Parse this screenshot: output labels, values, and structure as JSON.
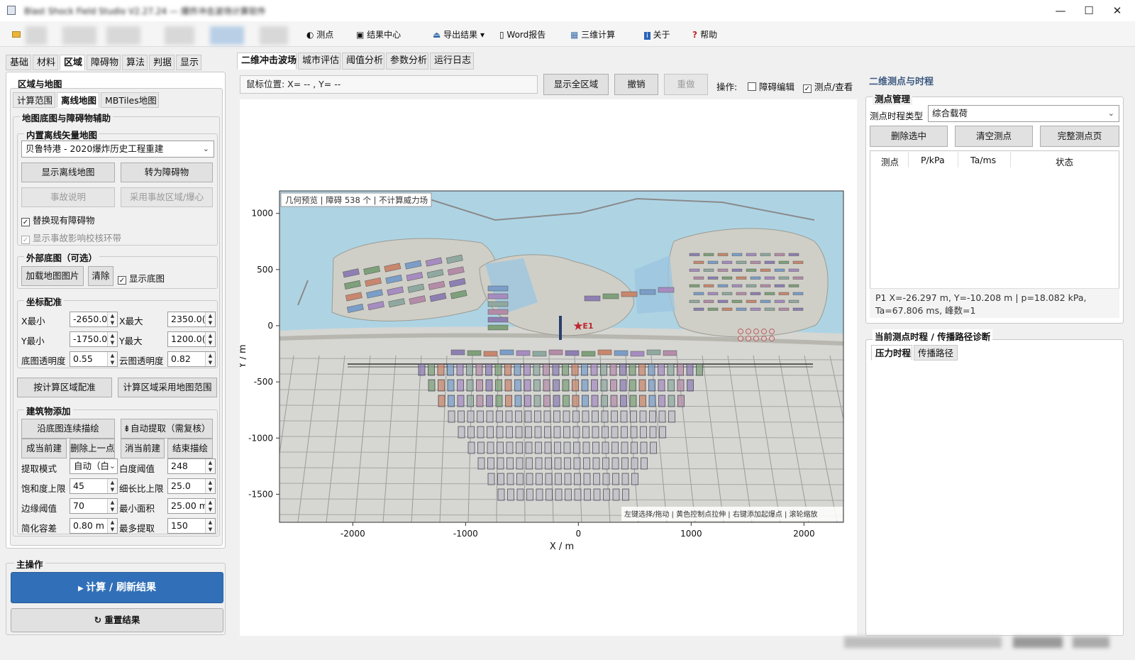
{
  "titlebar": {
    "min": "—",
    "max": "☐",
    "close": "✕"
  },
  "toolbar": {
    "measure": "测点",
    "results": "结果中心",
    "export": "导出结果",
    "word": "Word报告",
    "three_d": "三维计算",
    "about": "关于",
    "help": "帮助"
  },
  "left_tabs": [
    "基础",
    "材料",
    "区域",
    "障碍物",
    "算法",
    "判据",
    "显示"
  ],
  "region": {
    "title": "区域与地图",
    "subtabs": [
      "计算范围",
      "离线地图",
      "MBTiles地图"
    ],
    "basemap_title": "地图底图与障碍物辅助",
    "builtin_title": "内置离线矢量地图",
    "map_select": "贝鲁特港 - 2020爆炸历史工程重建",
    "show_offline": "显示离线地图",
    "to_obstacle": "转为障碍物",
    "accident_info": "事故说明",
    "use_accident": "采用事故区域/爆心",
    "replace_obstacles": "替换现有障碍物",
    "show_rings": "显示事故影响校核环带",
    "external_title": "外部底图（可选）",
    "load_image": "加载地图图片",
    "clear": "清除",
    "show_basemap": "显示底图",
    "coord_title": "坐标配准",
    "xmin_label": "X最小",
    "xmin": "-2650.0(",
    "xmax_label": "X最大",
    "xmax": "2350.0(",
    "ymin_label": "Y最小",
    "ymin": "-1750.0(",
    "ymax_label": "Y最大",
    "ymax": "1200.0(",
    "base_alpha_label": "底图透明度",
    "base_alpha": "0.55",
    "cloud_alpha_label": "云图透明度",
    "cloud_alpha": "0.82",
    "fit_region": "按计算区域配准",
    "use_map_range": "计算区域采用地图范围",
    "building_title": "建筑物添加",
    "trace": "沿底图连续描绘",
    "auto_extract": "⇟自动提取（需复核）",
    "finish_current": "成当前建",
    "delete_prev": "删除上一点",
    "cancel_current": "消当前建",
    "end_trace": "结束描绘",
    "mode_label": "提取模式",
    "mode": "自动（白",
    "white_label": "白度阈值",
    "white": "248",
    "sat_label": "饱和度上限",
    "sat": "45",
    "aspect_label": "细长比上限",
    "aspect": "25.0",
    "edge_label": "边缘阈值",
    "edge": "70",
    "min_area_label": "最小面积",
    "min_area": "25.00 m",
    "simplify_label": "简化容差",
    "simplify": "0.80 m",
    "max_extract_label": "最多提取",
    "max_extract": "150"
  },
  "main_ops": {
    "title": "主操作",
    "compute": "计算 / 刷新结果",
    "reset": "重置结果"
  },
  "center_tabs": [
    "二维冲击波场",
    "城市评估",
    "阈值分析",
    "参数分析",
    "运行日志"
  ],
  "center": {
    "mouse_pos": "鼠标位置:  X= -- , Y= --",
    "show_all": "显示全区域",
    "undo": "撤销",
    "redo": "重做",
    "ops_label": "操作:",
    "obstacle_edit": "障碍编辑",
    "probe_view": "测点/查看"
  },
  "chart_data": {
    "type": "scatter",
    "legend_text": "几何预览 | 障碍 538 个 | 不计算威力场",
    "hint": "左键选择/拖动 | 黄色控制点拉伸 | 右键添加起爆点 | 滚轮缩放",
    "xlabel": "X / m",
    "ylabel": "Y / m",
    "xlim": [
      -2650,
      2350
    ],
    "ylim": [
      -1750,
      1200
    ],
    "xticks": [
      "-2000",
      "-1000",
      "0",
      "1000",
      "2000"
    ],
    "yticks": [
      "1000",
      "500",
      "0",
      "-500",
      "-1000",
      "-1500"
    ],
    "points": [
      {
        "name": "E1",
        "x": 0,
        "y": 0
      }
    ]
  },
  "right": {
    "title": "二维测点与时程",
    "mgmt_title": "测点管理",
    "type_label": "测点时程类型",
    "type_value": "综合载荷",
    "del_selected": "删除选中",
    "clear_points": "清空测点",
    "full_page": "完整测点页",
    "columns": [
      "测点",
      "P/kPa",
      "Ta/ms",
      "状态"
    ],
    "info_line1": "P1  X=-26.297 m, Y=-10.208 m  |  p=18.082 kPa,",
    "info_line2": "Ta=67.806 ms, 峰数=1",
    "history_title": "当前测点时程 / 传播路径诊断",
    "history_tabs": [
      "压力时程",
      "传播路径"
    ]
  },
  "colors": {
    "accent": "#3170b8",
    "water": "#aed4e4",
    "land": "#d6d6d2",
    "burst": "#c0262d"
  }
}
